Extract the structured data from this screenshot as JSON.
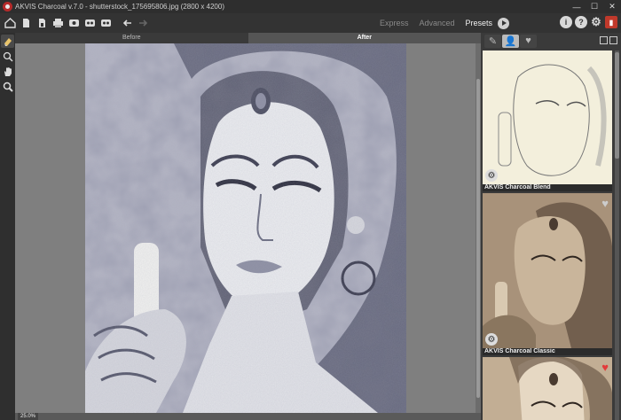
{
  "window": {
    "title": "AKVIS Charcoal v.7.0 - shutterstock_175695806.jpg (2800 x 4200)",
    "controls": {
      "minimize": "—",
      "maximize": "☐",
      "close": "✕"
    }
  },
  "toolbar": {
    "icons": [
      "home-icon",
      "open-icon",
      "save-icon",
      "print-icon",
      "batch-icon",
      "before-icon",
      "after-icon",
      "undo-icon",
      "redo-icon"
    ],
    "mode_tabs": [
      {
        "label": "Express",
        "active": false
      },
      {
        "label": "Advanced",
        "active": false
      },
      {
        "label": "Presets",
        "active": true
      }
    ],
    "right_tools": {
      "info": "i",
      "help": "?",
      "settings": "⚙",
      "manual": "📕"
    }
  },
  "left_tools": [
    "eraser-icon",
    "stamp-icon",
    "hand-icon",
    "zoom-icon"
  ],
  "canvas": {
    "tabs": [
      {
        "label": "Before",
        "active": false
      },
      {
        "label": "After",
        "active": true
      }
    ],
    "zoom": "25.0%"
  },
  "presets_panel": {
    "tabs": [
      "charcoal-presets-icon",
      "user-presets-icon",
      "favorites-icon"
    ],
    "presets": [
      {
        "label": "",
        "favorite": false,
        "tone": "#f3efdc"
      },
      {
        "label": "AKVIS Charcoal Blend",
        "favorite": false,
        "tone": "#a8927a"
      },
      {
        "label": "AKVIS Charcoal Classic",
        "favorite": true,
        "tone": "#c9b59b"
      }
    ]
  },
  "colors": {
    "accent_red": "#c0392b",
    "heart_red": "#e23b3b"
  }
}
